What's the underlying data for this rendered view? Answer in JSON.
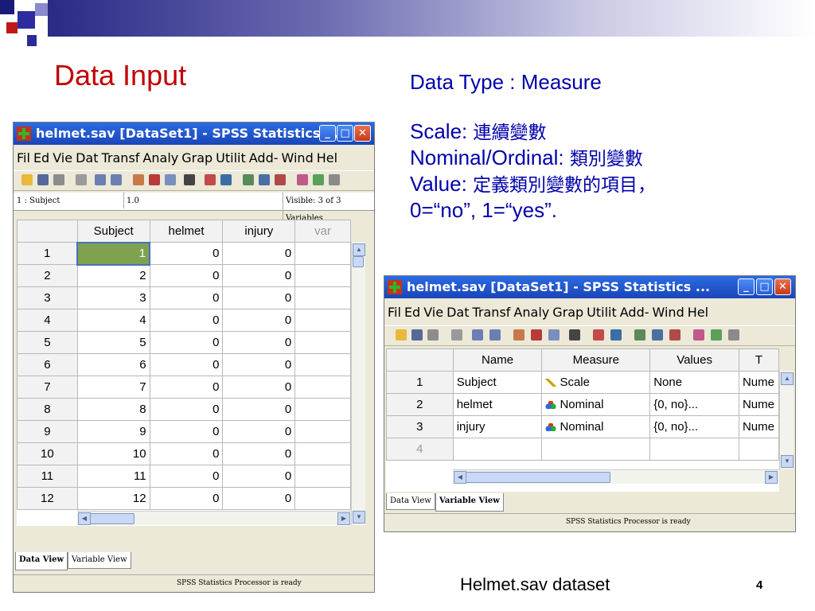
{
  "slide": {
    "title": "Data Input",
    "notes": {
      "heading": "Data Type : Measure",
      "scale_label": "Scale:",
      "scale_text": "連續變數",
      "nominal_label": "Nominal/Ordinal:",
      "nominal_text": "類別變數",
      "value_label": "Value:",
      "value_text": "定義類別變數的項目，",
      "value_example": "0=“no”, 1=“yes”."
    },
    "caption": "Helmet.sav dataset",
    "page_number": "4"
  },
  "data_window": {
    "title": "helmet.sav [DataSet1] - SPSS Statistics ...",
    "menu": [
      "Fil",
      "Ed",
      "Vie",
      "Dat",
      "Transf",
      "Analy",
      "Grap",
      "Utilit",
      "Add-",
      "Wind",
      "Hel"
    ],
    "cell_ref": "1 : Subject",
    "cell_value": "1.0",
    "visible": "Visible: 3 of 3 Variables",
    "columns": [
      "Subject",
      "helmet",
      "injury",
      "var"
    ],
    "rows": [
      [
        "1",
        "1",
        "0",
        "0"
      ],
      [
        "2",
        "2",
        "0",
        "0"
      ],
      [
        "3",
        "3",
        "0",
        "0"
      ],
      [
        "4",
        "4",
        "0",
        "0"
      ],
      [
        "5",
        "5",
        "0",
        "0"
      ],
      [
        "6",
        "6",
        "0",
        "0"
      ],
      [
        "7",
        "7",
        "0",
        "0"
      ],
      [
        "8",
        "8",
        "0",
        "0"
      ],
      [
        "9",
        "9",
        "0",
        "0"
      ],
      [
        "10",
        "10",
        "0",
        "0"
      ],
      [
        "11",
        "11",
        "0",
        "0"
      ],
      [
        "12",
        "12",
        "0",
        "0"
      ]
    ],
    "tabs": [
      "Data View",
      "Variable View"
    ],
    "status": "SPSS Statistics Processor is ready"
  },
  "variable_window": {
    "title": "helmet.sav [DataSet1] - SPSS Statistics ...",
    "menu": [
      "Fil",
      "Ed",
      "Vie",
      "Dat",
      "Transf",
      "Analy",
      "Grap",
      "Utilit",
      "Add-",
      "Wind",
      "Hel"
    ],
    "columns": [
      "Name",
      "Measure",
      "Values",
      "T"
    ],
    "rows": [
      {
        "num": "1",
        "name": "Subject",
        "measure": "Scale",
        "measure_icon": "ruler-icon",
        "values": "None",
        "type": "Nume"
      },
      {
        "num": "2",
        "name": "helmet",
        "measure": "Nominal",
        "measure_icon": "nominal-icon",
        "values": "{0, no}...",
        "type": "Nume"
      },
      {
        "num": "3",
        "name": "injury",
        "measure": "Nominal",
        "measure_icon": "nominal-icon",
        "values": "{0, no}...",
        "type": "Nume"
      },
      {
        "num": "4",
        "name": "",
        "measure": "",
        "measure_icon": "",
        "values": "",
        "type": ""
      }
    ],
    "tabs": [
      "Data View",
      "Variable View"
    ],
    "status": "SPSS Statistics Processor is ready"
  },
  "colors": {
    "title_red": "#c00000",
    "notes_blue": "#0000aa",
    "titlebar_blue": "#1945b8",
    "selected_cell": "#7fa24e"
  }
}
